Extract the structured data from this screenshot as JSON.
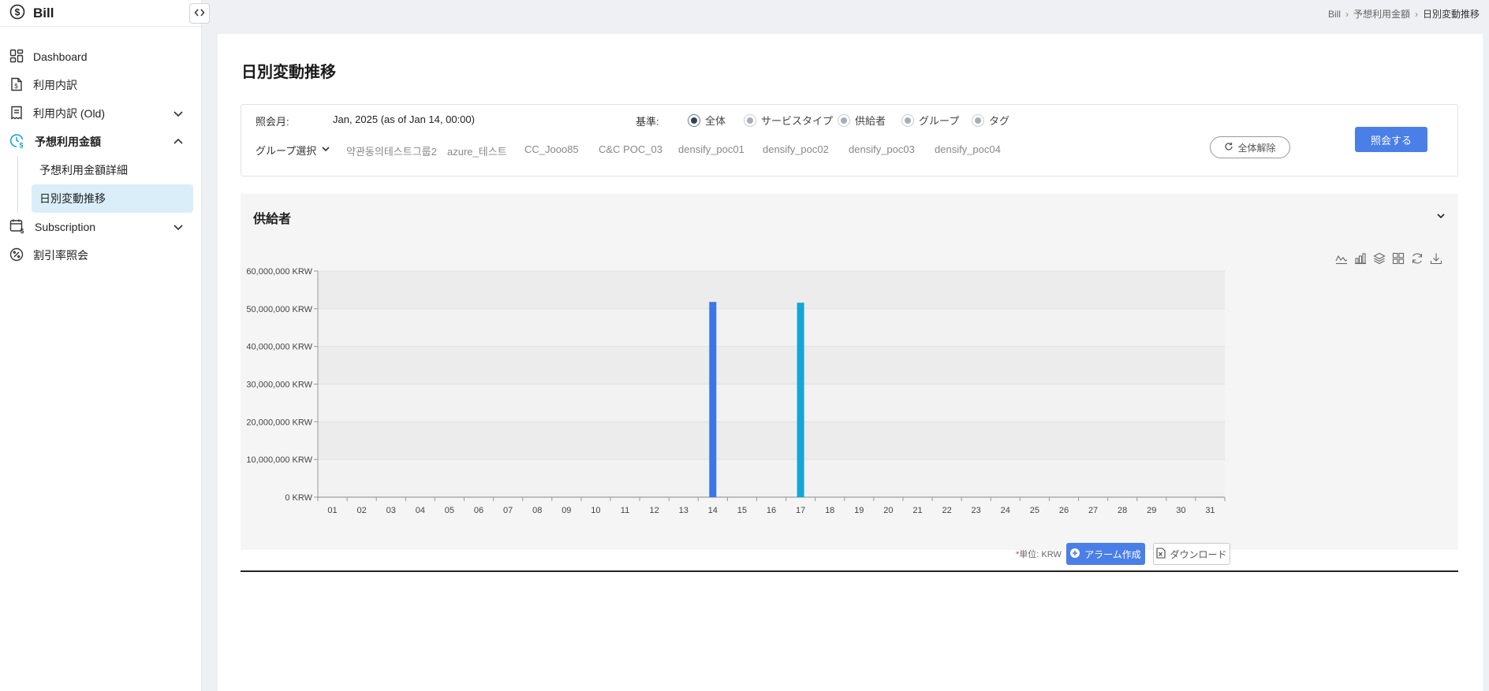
{
  "app": {
    "title": "Bill"
  },
  "sidebar": {
    "items": [
      {
        "label": "Dashboard",
        "icon": "dashboard-icon"
      },
      {
        "label": "利用内訳",
        "icon": "invoice-icon"
      },
      {
        "label": "利用内訳 (Old)",
        "icon": "receipt-icon",
        "chevron": "down"
      },
      {
        "label": "予想利用金額",
        "icon": "clock-dollar-icon",
        "chevron": "up",
        "active": true
      },
      {
        "label": "Subscription",
        "icon": "calendar-dollar-icon",
        "chevron": "down"
      },
      {
        "label": "割引率照会",
        "icon": "percent-icon"
      }
    ],
    "subitems": [
      {
        "label": "予想利用金額詳細"
      },
      {
        "label": "日別変動推移",
        "active": true
      }
    ]
  },
  "breadcrumb": [
    "Bill",
    "予想利用金額",
    "日別変動推移"
  ],
  "page": {
    "title": "日別変動推移"
  },
  "filters": {
    "month_label": "照会月:",
    "month_value": "Jan, 2025 (as of Jan 14, 00:00)",
    "basis_label": "基準:",
    "basis_options": [
      "全体",
      "サービスタイプ",
      "供給者",
      "グループ",
      "タグ"
    ],
    "basis_selected": "全体",
    "group_select_label": "グループ選択",
    "groups": [
      "약관동의테스트그룹2",
      "azure_테스트",
      "CC_Jooo85",
      "C&C POC_03",
      "densify_poc01",
      "densify_poc02",
      "densify_poc03",
      "densify_poc04"
    ],
    "reset_label": "全体解除",
    "query_label": "照会する"
  },
  "chart_panel": {
    "title": "供給者"
  },
  "chart_data": {
    "type": "bar",
    "categories": [
      "01",
      "02",
      "03",
      "04",
      "05",
      "06",
      "07",
      "08",
      "09",
      "10",
      "11",
      "12",
      "13",
      "14",
      "15",
      "16",
      "17",
      "18",
      "19",
      "20",
      "21",
      "22",
      "23",
      "24",
      "25",
      "26",
      "27",
      "28",
      "29",
      "30",
      "31"
    ],
    "series": [
      {
        "color": "#3b76e6",
        "values": [
          0,
          0,
          0,
          0,
          0,
          0,
          0,
          0,
          0,
          0,
          0,
          0,
          0,
          51800000,
          0,
          0,
          0,
          0,
          0,
          0,
          0,
          0,
          0,
          0,
          0,
          0,
          0,
          0,
          0,
          0,
          0
        ]
      },
      {
        "color": "#13a6d6",
        "values": [
          0,
          0,
          0,
          0,
          0,
          0,
          0,
          0,
          0,
          0,
          0,
          0,
          0,
          0,
          0,
          0,
          51600000,
          0,
          0,
          0,
          0,
          0,
          0,
          0,
          0,
          0,
          0,
          0,
          0,
          0,
          0
        ]
      }
    ],
    "ylim": [
      0,
      60000000
    ],
    "yticks": [
      0,
      10000000,
      20000000,
      30000000,
      40000000,
      50000000,
      60000000
    ],
    "ytick_labels": [
      "0 KRW",
      "10,000,000 KRW",
      "20,000,000 KRW",
      "30,000,000 KRW",
      "40,000,000 KRW",
      "50,000,000 KRW",
      "60,000,000 KRW"
    ],
    "grid": true
  },
  "footer": {
    "unit_star": "*",
    "unit_label": "単位: KRW",
    "alarm_label": "アラーム作成",
    "download_label": "ダウンロード"
  }
}
